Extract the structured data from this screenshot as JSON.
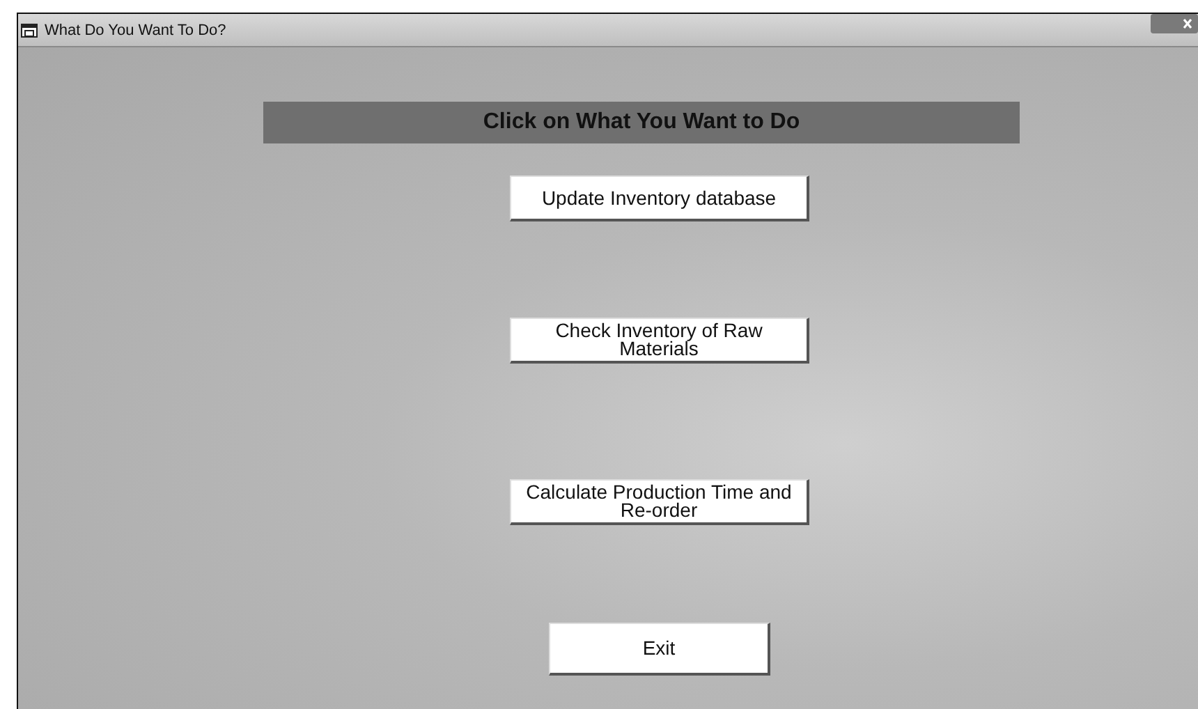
{
  "window": {
    "title": "What Do You Want To Do?"
  },
  "heading": "Click on What You Want to Do",
  "buttons": [
    {
      "label": "Update Inventory database",
      "kind": "action"
    },
    {
      "label": "Check Inventory of Raw Materials",
      "kind": "action"
    },
    {
      "label": "Calculate Production Time and Re-order",
      "kind": "action"
    },
    {
      "label": "Exit",
      "kind": "exit"
    }
  ]
}
